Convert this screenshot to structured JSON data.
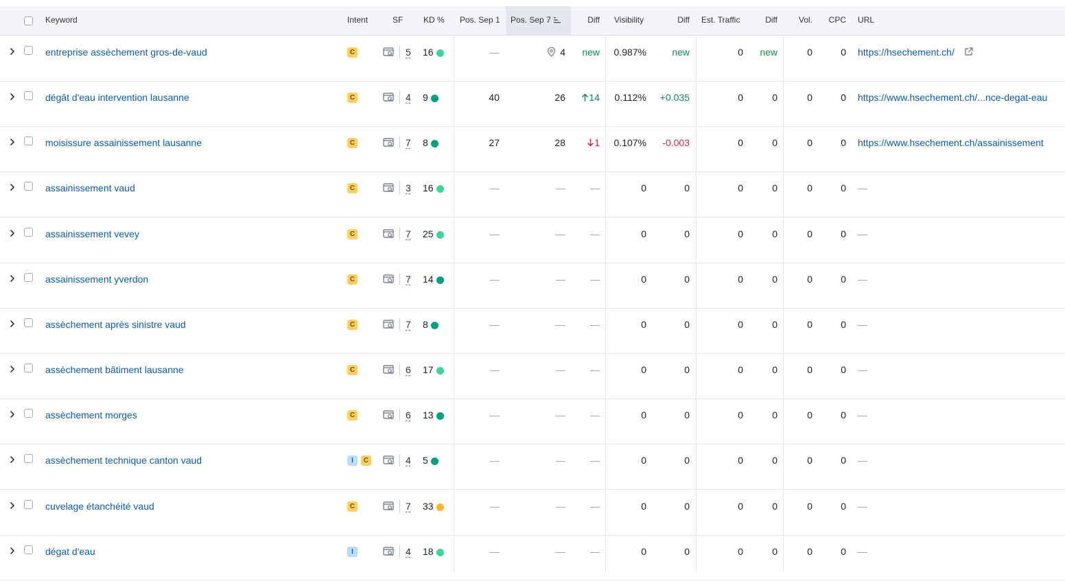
{
  "header": {
    "keyword": "Keyword",
    "intent": "Intent",
    "sf": "SF",
    "kd": "KD %",
    "pos_sep1": "Pos. Sep 1",
    "pos_sep7": "Pos. Sep 7",
    "diff_pos": "Diff",
    "visibility": "Visibility",
    "diff_vis": "Diff",
    "est_traffic": "Est. Traffic",
    "diff_traffic": "Diff",
    "vol": "Vol.",
    "cpc": "CPC",
    "url": "URL"
  },
  "colors": {
    "kd_light_green": "#3ed49a",
    "kd_dark_green": "#009f81",
    "kd_orange": "#fdb62b",
    "link": "#0d5ba8",
    "positive": "#0e8a4f",
    "negative": "#d8253f"
  },
  "rows": [
    {
      "keyword": "entreprise assèchement gros-de-vaud",
      "intent": [
        "C"
      ],
      "sf": "5",
      "kd": "16",
      "kd_color": "#3ed49a",
      "pos1": "—",
      "pos7": "4",
      "pos7_icon": "map-pin-icon",
      "diff": "new",
      "diff_dir": "new",
      "vis": "0.987%",
      "vis_diff": "new",
      "vis_diff_dir": "pos",
      "traffic": "0",
      "traffic_diff": "new",
      "traffic_diff_dir": "pos",
      "vol": "0",
      "cpc": "0",
      "url": "https://hsechement.ch/",
      "url_ext": true
    },
    {
      "keyword": "dégât d'eau intervention lausanne",
      "intent": [
        "C"
      ],
      "sf": "4",
      "kd": "9",
      "kd_color": "#009f81",
      "pos1": "40",
      "pos7": "26",
      "diff": "14",
      "diff_dir": "up",
      "vis": "0.112%",
      "vis_diff": "+0.035",
      "vis_diff_dir": "pos",
      "traffic": "0",
      "traffic_diff": "0",
      "vol": "0",
      "cpc": "0",
      "url": "https://www.hsechement.ch/...nce-degat-eau"
    },
    {
      "keyword": "moisissure assainissement lausanne",
      "intent": [
        "C"
      ],
      "sf": "7",
      "kd": "8",
      "kd_color": "#009f81",
      "pos1": "27",
      "pos7": "28",
      "diff": "1",
      "diff_dir": "down",
      "vis": "0.107%",
      "vis_diff": "-0.003",
      "vis_diff_dir": "neg",
      "traffic": "0",
      "traffic_diff": "0",
      "vol": "0",
      "cpc": "0",
      "url": "https://www.hsechement.ch/assainissement"
    },
    {
      "keyword": "assainissement vaud",
      "intent": [
        "C"
      ],
      "sf": "3",
      "kd": "16",
      "kd_color": "#3ed49a",
      "pos1": "—",
      "pos7": "—",
      "diff": "—",
      "diff_dir": "none",
      "vis": "0",
      "vis_diff": "0",
      "traffic": "0",
      "traffic_diff": "0",
      "vol": "0",
      "cpc": "0",
      "url": "—"
    },
    {
      "keyword": "assainissement vevey",
      "intent": [
        "C"
      ],
      "sf": "7",
      "kd": "25",
      "kd_color": "#3ed49a",
      "pos1": "—",
      "pos7": "—",
      "diff": "—",
      "diff_dir": "none",
      "vis": "0",
      "vis_diff": "0",
      "traffic": "0",
      "traffic_diff": "0",
      "vol": "0",
      "cpc": "0",
      "url": "—"
    },
    {
      "keyword": "assainissement yverdon",
      "intent": [
        "C"
      ],
      "sf": "7",
      "kd": "14",
      "kd_color": "#009f81",
      "pos1": "—",
      "pos7": "—",
      "diff": "—",
      "diff_dir": "none",
      "vis": "0",
      "vis_diff": "0",
      "traffic": "0",
      "traffic_diff": "0",
      "vol": "0",
      "cpc": "0",
      "url": "—"
    },
    {
      "keyword": "assèchement après sinistre vaud",
      "intent": [
        "C"
      ],
      "sf": "7",
      "kd": "8",
      "kd_color": "#009f81",
      "pos1": "—",
      "pos7": "—",
      "diff": "—",
      "diff_dir": "none",
      "vis": "0",
      "vis_diff": "0",
      "traffic": "0",
      "traffic_diff": "0",
      "vol": "0",
      "cpc": "0",
      "url": "—"
    },
    {
      "keyword": "assèchement bâtiment lausanne",
      "intent": [
        "C"
      ],
      "sf": "6",
      "kd": "17",
      "kd_color": "#3ed49a",
      "pos1": "—",
      "pos7": "—",
      "diff": "—",
      "diff_dir": "none",
      "vis": "0",
      "vis_diff": "0",
      "traffic": "0",
      "traffic_diff": "0",
      "vol": "0",
      "cpc": "0",
      "url": "—"
    },
    {
      "keyword": "assèchement morges",
      "intent": [
        "C"
      ],
      "sf": "6",
      "kd": "13",
      "kd_color": "#009f81",
      "pos1": "—",
      "pos7": "—",
      "diff": "—",
      "diff_dir": "none",
      "vis": "0",
      "vis_diff": "0",
      "traffic": "0",
      "traffic_diff": "0",
      "vol": "0",
      "cpc": "0",
      "url": "—"
    },
    {
      "keyword": "assèchement technique canton vaud",
      "intent": [
        "I",
        "C"
      ],
      "sf": "4",
      "kd": "5",
      "kd_color": "#009f81",
      "pos1": "—",
      "pos7": "—",
      "diff": "—",
      "diff_dir": "none",
      "vis": "0",
      "vis_diff": "0",
      "traffic": "0",
      "traffic_diff": "0",
      "vol": "0",
      "cpc": "0",
      "url": "—"
    },
    {
      "keyword": "cuvelage étanchéité vaud",
      "intent": [
        "C"
      ],
      "sf": "7",
      "kd": "33",
      "kd_color": "#fdb62b",
      "pos1": "—",
      "pos7": "—",
      "diff": "—",
      "diff_dir": "none",
      "vis": "0",
      "vis_diff": "0",
      "traffic": "0",
      "traffic_diff": "0",
      "vol": "0",
      "cpc": "0",
      "url": "—"
    },
    {
      "keyword": "dégat d'eau",
      "intent": [
        "I"
      ],
      "sf": "4",
      "kd": "18",
      "kd_color": "#3ed49a",
      "pos1": "—",
      "pos7": "—",
      "diff": "—",
      "diff_dir": "none",
      "vis": "0",
      "vis_diff": "0",
      "traffic": "0",
      "traffic_diff": "0",
      "vol": "0",
      "cpc": "0",
      "url": "—"
    }
  ]
}
